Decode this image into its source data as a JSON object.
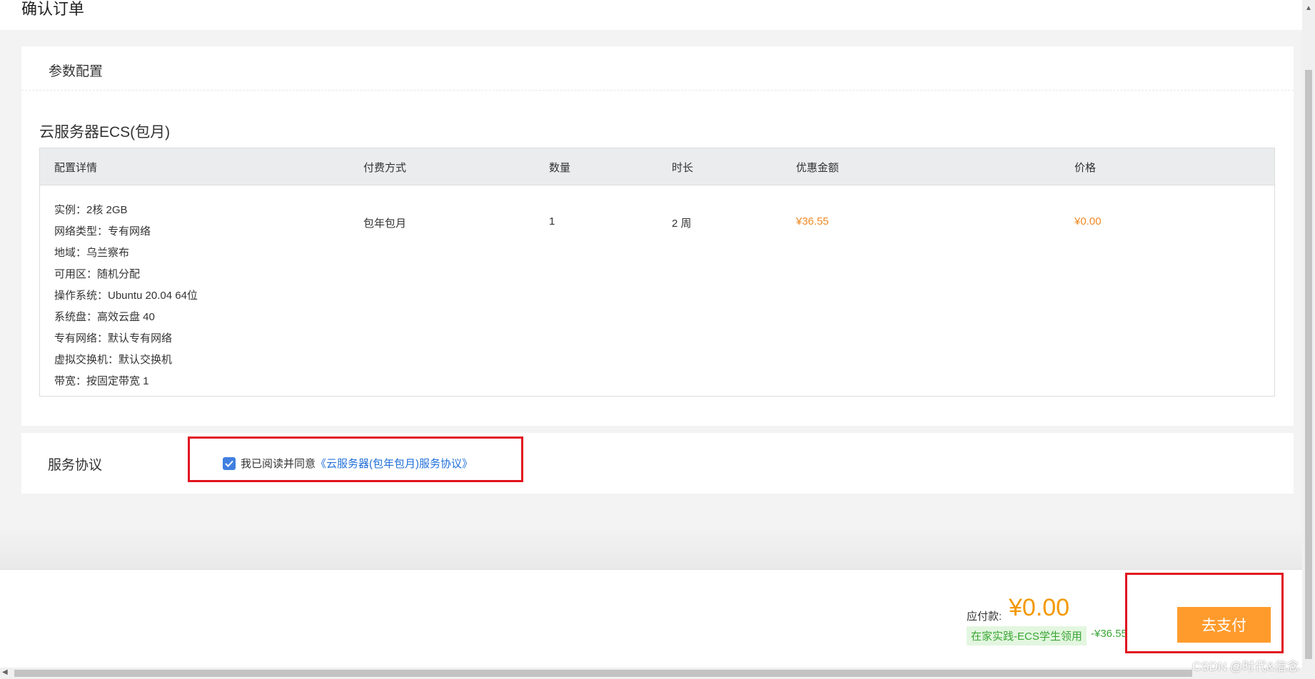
{
  "page": {
    "title": "确认订单"
  },
  "config_panel": {
    "header": "参数配置",
    "product_title": "云服务器ECS(包月)",
    "columns": [
      "配置详情",
      "付费方式",
      "数量",
      "时长",
      "优惠金额",
      "价格"
    ],
    "row": {
      "specs": [
        "实例：2核 2GB",
        "网络类型：专有网络",
        "地域：乌兰察布",
        "可用区：随机分配",
        "操作系统：Ubuntu 20.04 64位",
        "系统盘：高效云盘 40",
        "专有网络：默认专有网络",
        "虚拟交换机：默认交换机",
        "带宽：按固定带宽 1"
      ],
      "payment": "包年包月",
      "quantity": "1",
      "duration": "2 周",
      "discount": "¥36.55",
      "price": "¥0.00"
    }
  },
  "agreement": {
    "label": "服务协议",
    "checked": true,
    "text": "我已阅读并同意",
    "link": "《云服务器(包年包月)服务协议》"
  },
  "footer": {
    "pay_label": "应付款:",
    "pay_amount": "¥0.00",
    "promo_tag": "在家实践-ECS学生领用",
    "promo_amount": "-¥36.55",
    "pay_button": "去支付"
  },
  "watermark": "CSDN @时代&信念",
  "colors": {
    "accent_orange": "#f39800",
    "button_orange": "#ff9b2d",
    "link_blue": "#1f6fd8",
    "promo_green": "#3aa635",
    "highlight_red": "#e1141e"
  }
}
